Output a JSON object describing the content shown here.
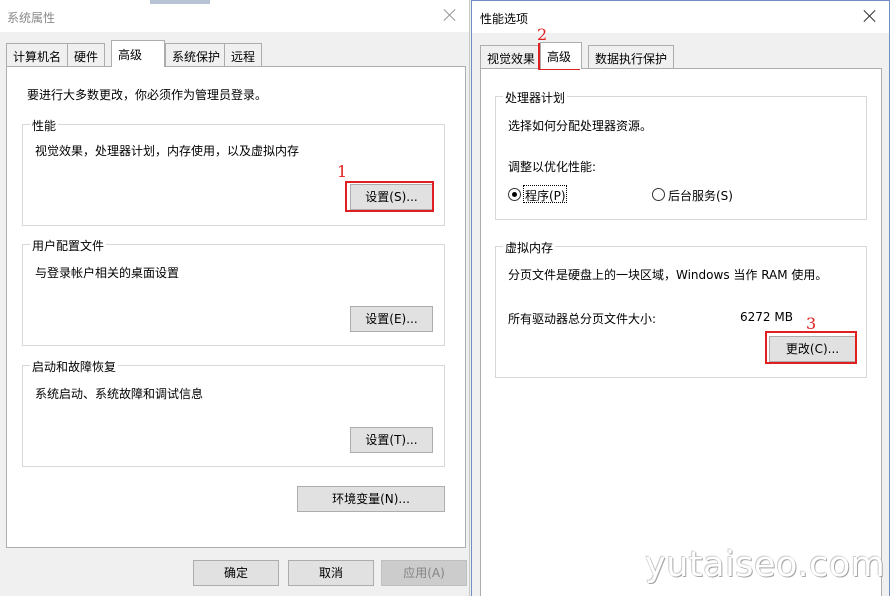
{
  "left_window": {
    "title": "系统属性",
    "tabs": [
      "计算机名",
      "硬件",
      "高级",
      "系统保护",
      "远程"
    ],
    "intro": "要进行大多数更改，你必须作为管理员登录。",
    "performance": {
      "label": "性能",
      "description": "视觉效果，处理器计划，内存使用，以及虚拟内存",
      "button": "设置(S)..."
    },
    "user_profile": {
      "label": "用户配置文件",
      "description": "与登录帐户相关的桌面设置",
      "button": "设置(E)..."
    },
    "startup_recovery": {
      "label": "启动和故障恢复",
      "description": "系统启动、系统故障和调试信息",
      "button": "设置(T)..."
    },
    "env_button": "环境变量(N)...",
    "ok": "确定",
    "cancel": "取消",
    "apply": "应用(A)"
  },
  "right_window": {
    "title": "性能选项",
    "tabs": [
      "视觉效果",
      "高级",
      "数据执行保护"
    ],
    "processor": {
      "label": "处理器计划",
      "description": "选择如何分配处理器资源。",
      "optimize_label": "调整以优化性能:",
      "option_programs": "程序(P)",
      "option_background": "后台服务(S)",
      "selected": "程序(P)"
    },
    "virtual_memory": {
      "label": "虚拟内存",
      "description": "分页文件是硬盘上的一块区域，Windows 当作 RAM 使用。",
      "total_label": "所有驱动器总分页文件大小:",
      "total_value": "6272 MB",
      "change_button": "更改(C)..."
    }
  },
  "annotations": [
    "1",
    "2",
    "3"
  ],
  "watermark": "yutaiseo.com",
  "colors": {
    "highlight": "#e02020",
    "tab_border": "#adadad",
    "panel_bg": "#ffffff",
    "window_bg": "#f0f0f0"
  }
}
